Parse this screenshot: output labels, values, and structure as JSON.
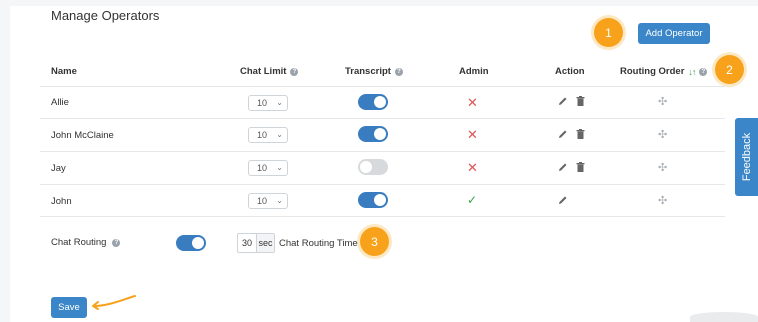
{
  "page": {
    "title": "Manage Operators"
  },
  "toolbar": {
    "add_operator_label": "Add Operator"
  },
  "badges": [
    "1",
    "2",
    "3"
  ],
  "table": {
    "headers": {
      "name": "Name",
      "chat_limit": "Chat Limit",
      "transcript": "Transcript",
      "admin": "Admin",
      "action": "Action",
      "routing_order": "Routing Order"
    },
    "rows": [
      {
        "name": "Allie",
        "chat_limit": "10",
        "transcript": true,
        "admin": false,
        "can_delete": true
      },
      {
        "name": "John McClaine",
        "chat_limit": "10",
        "transcript": true,
        "admin": false,
        "can_delete": true
      },
      {
        "name": "Jay",
        "chat_limit": "10",
        "transcript": false,
        "admin": false,
        "can_delete": true
      },
      {
        "name": "John",
        "chat_limit": "10",
        "transcript": true,
        "admin": true,
        "can_delete": false
      }
    ]
  },
  "chat_routing": {
    "label": "Chat Routing",
    "enabled": true,
    "time_value": "30",
    "time_unit": "sec",
    "time_label": "Chat Routing Time"
  },
  "footer": {
    "save_label": "Save"
  },
  "feedback_tab": {
    "label": "Feedback"
  },
  "colors": {
    "primary": "#3a86c8",
    "badge": "#f7a21a",
    "danger": "#e05454",
    "success": "#3aa14a",
    "toggle_on": "#3a7cc0",
    "toggle_off": "#d7dadd"
  },
  "icons": [
    "help-icon",
    "sort-icon",
    "edit-icon",
    "delete-icon",
    "close-icon",
    "check-icon",
    "drag-icon",
    "chevron-down-icon",
    "arrow-icon"
  ]
}
